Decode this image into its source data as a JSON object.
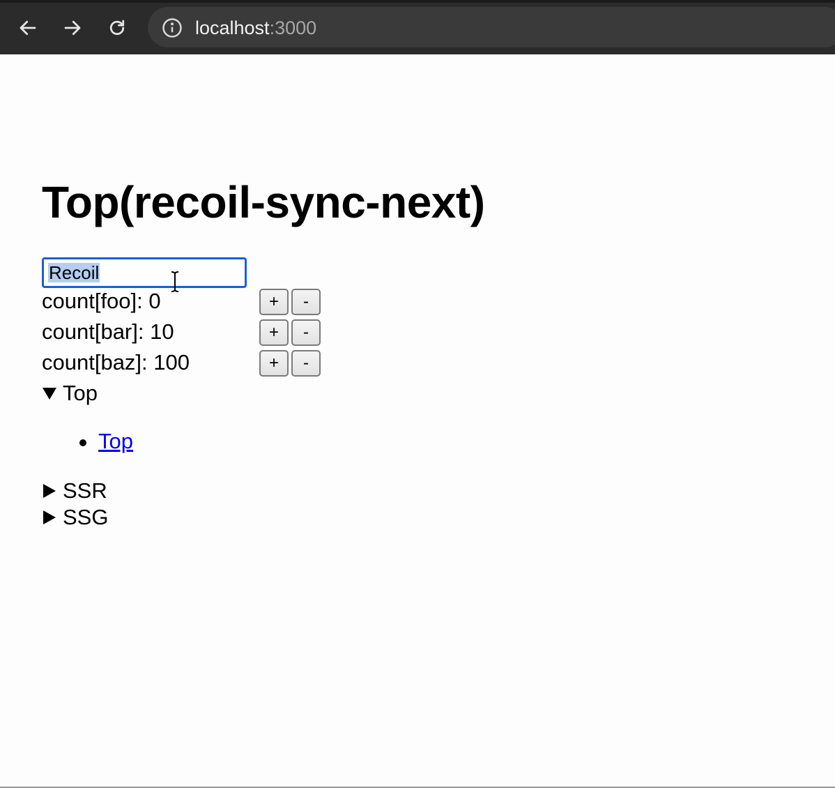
{
  "browser": {
    "url_host": "localhost",
    "url_port": ":3000"
  },
  "page": {
    "title": "Top(recoil-sync-next)",
    "input_value": "Recoil",
    "counters": [
      {
        "label": "count[foo]: 0",
        "plus": "+",
        "minus": "-"
      },
      {
        "label": "count[bar]: 10",
        "plus": "+",
        "minus": "-"
      },
      {
        "label": "count[baz]: 100",
        "plus": "+",
        "minus": "-"
      }
    ],
    "sections": [
      {
        "label": "Top",
        "open": true,
        "links": [
          "Top"
        ]
      },
      {
        "label": "SSR",
        "open": false
      },
      {
        "label": "SSG",
        "open": false
      }
    ]
  },
  "colors": {
    "chrome_bg": "#2b2b2b",
    "focus_ring": "#1a5fd6",
    "selection": "#b4cdf1",
    "link": "#0000ee"
  }
}
